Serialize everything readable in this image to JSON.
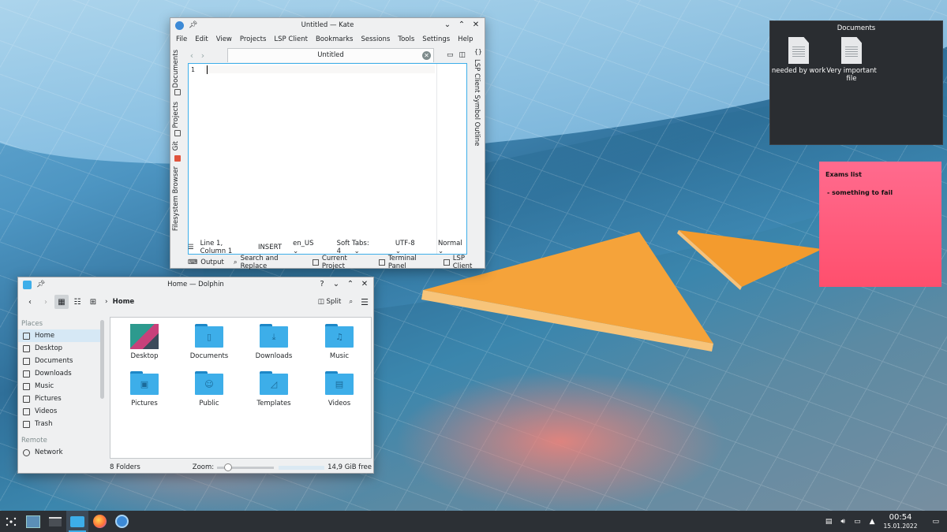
{
  "kate": {
    "title": "Untitled — Kate",
    "menu": [
      "File",
      "Edit",
      "View",
      "Projects",
      "LSP Client",
      "Bookmarks",
      "Sessions",
      "Tools",
      "Settings",
      "Help"
    ],
    "left_tabs": [
      "Documents",
      "Projects",
      "Git",
      "Filesystem Browser"
    ],
    "right_tab": "LSP Client Symbol Outline",
    "doc_tab": "Untitled",
    "line_number": "1",
    "status": {
      "position": "Line 1, Column 1",
      "mode": "INSERT",
      "lang": "en_US",
      "tabs": "Soft Tabs: 4",
      "encoding": "UTF-8",
      "input": "Normal"
    },
    "tools": [
      "Output",
      "Search and Replace",
      "Current Project",
      "Terminal Panel",
      "LSP Client"
    ]
  },
  "dolphin": {
    "title": "Home — Dolphin",
    "breadcrumb": "Home",
    "split_label": "Split",
    "places_header": "Places",
    "places": [
      "Home",
      "Desktop",
      "Documents",
      "Downloads",
      "Music",
      "Pictures",
      "Videos",
      "Trash"
    ],
    "remote_header": "Remote",
    "remote": [
      "Network"
    ],
    "items": [
      "Desktop",
      "Documents",
      "Downloads",
      "Music",
      "Pictures",
      "Public",
      "Templates",
      "Videos"
    ],
    "status_count": "8 Folders",
    "zoom_label": "Zoom:",
    "zoom_level": 0.15,
    "free_space": "14,9 GiB free"
  },
  "folder_widget": {
    "title": "Documents",
    "files": [
      "needed by work",
      "Very important file"
    ]
  },
  "note": {
    "title": "Exams list",
    "line": " - something to fail"
  },
  "clock": {
    "time": "00:54",
    "date": "15.01.2022"
  },
  "colors": {
    "accent": "#3daee9",
    "note": "#ff5a78",
    "taskbar": "#2c3035"
  }
}
